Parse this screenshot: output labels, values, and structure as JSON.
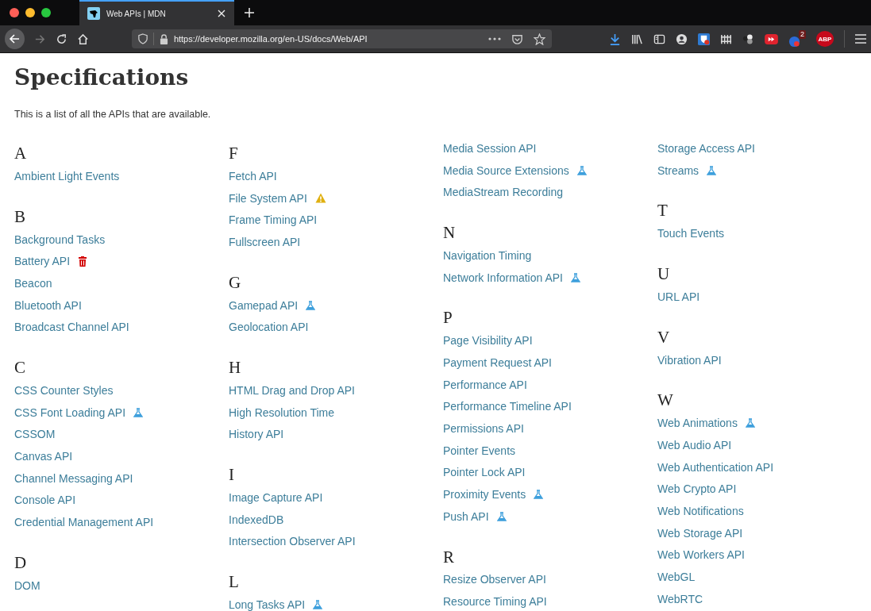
{
  "tab": {
    "title": "Web APIs | MDN",
    "selected": true
  },
  "address_bar": {
    "url": "https://developer.mozilla.org/en-US/docs/Web/API"
  },
  "toolbar_icons": [
    {
      "kind": "download"
    },
    {
      "kind": "library"
    },
    {
      "kind": "sidebar"
    },
    {
      "kind": "account"
    },
    {
      "kind": "shield"
    },
    {
      "kind": "fence"
    },
    {
      "kind": "dots"
    },
    {
      "kind": "play"
    },
    {
      "kind": "globe",
      "badge": "2"
    },
    {
      "kind": "stop",
      "text": "ABP"
    }
  ],
  "page": {
    "title": "Specifications",
    "intro": "This is a list of all the APIs that are available."
  },
  "columns": [
    {
      "entries": [
        {
          "kind": "letter",
          "text": "A"
        },
        {
          "kind": "link",
          "text": "Ambient Light Events"
        },
        {
          "kind": "letter",
          "text": "B"
        },
        {
          "kind": "link",
          "text": "Background Tasks"
        },
        {
          "kind": "link",
          "text": "Battery API",
          "deprecated": true
        },
        {
          "kind": "link",
          "text": "Beacon"
        },
        {
          "kind": "link",
          "text": "Bluetooth API"
        },
        {
          "kind": "link",
          "text": "Broadcast Channel API"
        },
        {
          "kind": "letter",
          "text": "C"
        },
        {
          "kind": "link",
          "text": "CSS Counter Styles"
        },
        {
          "kind": "link",
          "text": "CSS Font Loading API",
          "experimental": true
        },
        {
          "kind": "link",
          "text": "CSSOM"
        },
        {
          "kind": "link",
          "text": "Canvas API"
        },
        {
          "kind": "link",
          "text": "Channel Messaging API"
        },
        {
          "kind": "link",
          "text": "Console API"
        },
        {
          "kind": "link",
          "text": "Credential Management API"
        },
        {
          "kind": "letter",
          "text": "D"
        },
        {
          "kind": "link",
          "text": "DOM"
        }
      ]
    },
    {
      "entries": [
        {
          "kind": "letter",
          "text": "F"
        },
        {
          "kind": "link",
          "text": "Fetch API"
        },
        {
          "kind": "link",
          "text": "File System API",
          "non_standard": true
        },
        {
          "kind": "link",
          "text": "Frame Timing API"
        },
        {
          "kind": "link",
          "text": "Fullscreen API"
        },
        {
          "kind": "letter",
          "text": "G"
        },
        {
          "kind": "link",
          "text": "Gamepad API",
          "experimental": true
        },
        {
          "kind": "link",
          "text": "Geolocation API"
        },
        {
          "kind": "letter",
          "text": "H"
        },
        {
          "kind": "link",
          "text": "HTML Drag and Drop API"
        },
        {
          "kind": "link",
          "text": "High Resolution Time"
        },
        {
          "kind": "link",
          "text": "History API"
        },
        {
          "kind": "letter",
          "text": "I"
        },
        {
          "kind": "link",
          "text": "Image Capture API"
        },
        {
          "kind": "link",
          "text": "IndexedDB"
        },
        {
          "kind": "link",
          "text": "Intersection Observer API"
        },
        {
          "kind": "letter",
          "text": "L"
        },
        {
          "kind": "link",
          "text": "Long Tasks API",
          "experimental": true
        }
      ]
    },
    {
      "entries": [
        {
          "kind": "link",
          "text": "Media Session API"
        },
        {
          "kind": "link",
          "text": "Media Source Extensions",
          "experimental": true
        },
        {
          "kind": "link",
          "text": "MediaStream Recording"
        },
        {
          "kind": "letter",
          "text": "N"
        },
        {
          "kind": "link",
          "text": "Navigation Timing"
        },
        {
          "kind": "link",
          "text": "Network Information API",
          "experimental": true
        },
        {
          "kind": "letter",
          "text": "P"
        },
        {
          "kind": "link",
          "text": "Page Visibility API"
        },
        {
          "kind": "link",
          "text": "Payment Request API"
        },
        {
          "kind": "link",
          "text": "Performance API"
        },
        {
          "kind": "link",
          "text": "Performance Timeline API"
        },
        {
          "kind": "link",
          "text": "Permissions API"
        },
        {
          "kind": "link",
          "text": "Pointer Events"
        },
        {
          "kind": "link",
          "text": "Pointer Lock API"
        },
        {
          "kind": "link",
          "text": "Proximity Events",
          "experimental": true
        },
        {
          "kind": "link",
          "text": "Push API",
          "experimental": true
        },
        {
          "kind": "letter",
          "text": "R"
        },
        {
          "kind": "link",
          "text": "Resize Observer API"
        },
        {
          "kind": "link",
          "text": "Resource Timing API"
        }
      ]
    },
    {
      "entries": [
        {
          "kind": "link",
          "text": "Storage Access API"
        },
        {
          "kind": "link",
          "text": "Streams",
          "experimental": true
        },
        {
          "kind": "letter",
          "text": "T"
        },
        {
          "kind": "link",
          "text": "Touch Events"
        },
        {
          "kind": "letter",
          "text": "U"
        },
        {
          "kind": "link",
          "text": "URL API"
        },
        {
          "kind": "letter",
          "text": "V"
        },
        {
          "kind": "link",
          "text": "Vibration API"
        },
        {
          "kind": "letter",
          "text": "W"
        },
        {
          "kind": "link",
          "text": "Web Animations",
          "experimental": true
        },
        {
          "kind": "link",
          "text": "Web Audio API"
        },
        {
          "kind": "link",
          "text": "Web Authentication API"
        },
        {
          "kind": "link",
          "text": "Web Crypto API"
        },
        {
          "kind": "link",
          "text": "Web Notifications"
        },
        {
          "kind": "link",
          "text": "Web Storage API"
        },
        {
          "kind": "link",
          "text": "Web Workers API"
        },
        {
          "kind": "link",
          "text": "WebGL"
        },
        {
          "kind": "link",
          "text": "WebRTC"
        }
      ]
    }
  ]
}
